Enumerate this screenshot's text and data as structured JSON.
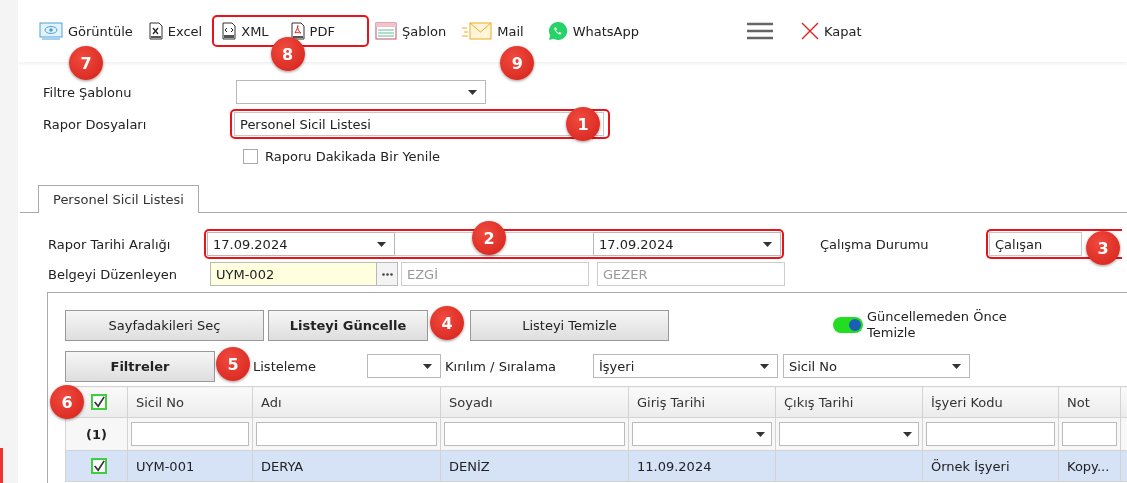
{
  "toolbar": [
    {
      "kind": "view",
      "label": "Görüntüle",
      "callout": "7"
    },
    {
      "kind": "excel",
      "label": "Excel"
    },
    {
      "kind": "group",
      "highlighted": true,
      "callout": "8",
      "items": [
        {
          "kind": "xml",
          "label": "XML"
        },
        {
          "kind": "pdf",
          "label": "PDF"
        }
      ]
    },
    {
      "kind": "template",
      "label": "Şablon"
    },
    {
      "kind": "mail",
      "label": "Mail",
      "callout": "9"
    },
    {
      "kind": "whatsapp",
      "label": "WhatsApp"
    },
    {
      "kind": "menu"
    },
    {
      "kind": "close",
      "label": "Kapat"
    }
  ],
  "filter_template": {
    "label": "Filtre Şablonu"
  },
  "report_files": {
    "label": "Rapor Dosyaları",
    "value": "Personel Sicil Listesi",
    "highlighted": true,
    "callout": "1"
  },
  "refresh_checkbox": {
    "label": "Raporu Dakikada Bir Yenile",
    "checked": false
  },
  "tabs": [
    {
      "label": "Personel Sicil Listesi",
      "selected": true
    }
  ],
  "date_range": {
    "label": "Rapor Tarihi Aralığı",
    "start": "17.09.2024",
    "end": "17.09.2024",
    "highlighted": true,
    "callout": "2"
  },
  "work_status": {
    "label": "Çalışma Durumu",
    "value": "Çalışan",
    "highlighted": true,
    "callout": "3"
  },
  "editor": {
    "label": "Belgeyi Düzenleyen",
    "code": "UYM-002",
    "first_name": "EZGİ",
    "last_name": "GEZER"
  },
  "buttons": [
    {
      "label": "Sayfadakileri Seç",
      "kind": "normal"
    },
    {
      "label": "Listeyi Güncelle",
      "kind": "primary",
      "callout": "4"
    },
    {
      "label": "Listeyi Temizle",
      "kind": "normal"
    }
  ],
  "toggle": {
    "label": "Güncellemeden Önce Temizle",
    "on": true
  },
  "filters_button": {
    "label": "Filtreler",
    "callout": "5"
  },
  "listing": {
    "label": "Listeleme"
  },
  "grouping": {
    "label": "Kırılım / Sıralama",
    "values": [
      "İşyeri",
      "Sicil No"
    ]
  },
  "table": {
    "header_checked": true,
    "callout": "6",
    "filter_count": "(1)",
    "columns": [
      {
        "label": "Sicil No",
        "kind": "text"
      },
      {
        "label": "Adı",
        "kind": "text"
      },
      {
        "label": "Soyadı",
        "kind": "text"
      },
      {
        "label": "Giriş Tarihi",
        "kind": "date"
      },
      {
        "label": "Çıkış Tarihi",
        "kind": "date"
      },
      {
        "label": "İşyeri Kodu",
        "kind": "text"
      },
      {
        "label": "Not",
        "kind": "text"
      }
    ],
    "rows": [
      {
        "checked": true,
        "selected": true,
        "cells": [
          "UYM-001",
          "DERYA",
          "DENİZ",
          "11.09.2024",
          "",
          "Örnek İşyeri",
          "Kopy..."
        ]
      }
    ]
  }
}
